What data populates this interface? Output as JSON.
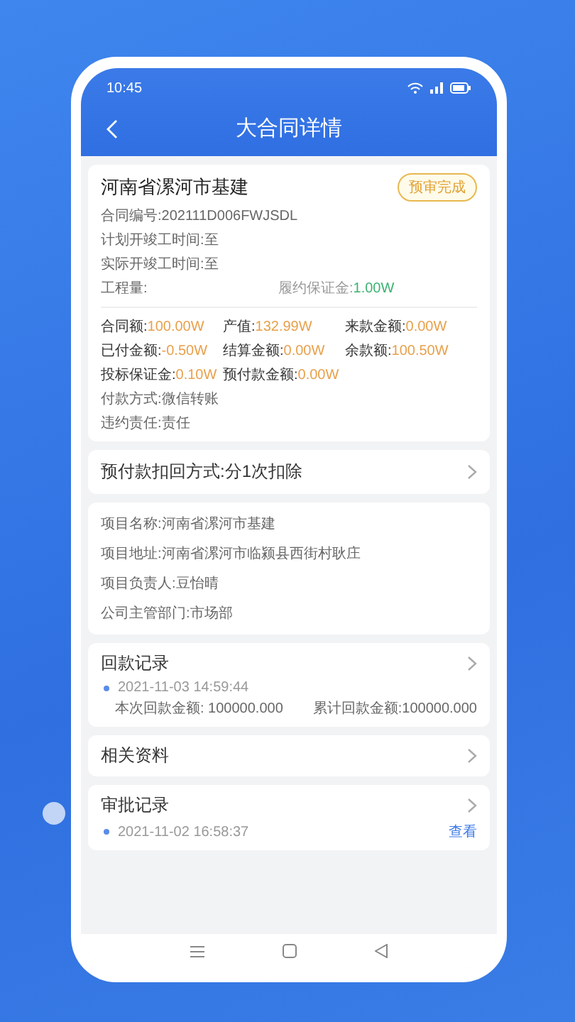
{
  "status_bar": {
    "time": "10:45"
  },
  "header": {
    "title": "大合同详情"
  },
  "contract": {
    "name": "河南省漯河市基建",
    "badge": "预审完成",
    "lines": [
      "合同编号:202111D006FWJSDL",
      "计划开竣工时间:至",
      "实际开竣工时间:至"
    ],
    "quantity_label": "工程量:",
    "deposit": {
      "label": "履约保证金:",
      "value": "1.00W"
    },
    "amounts": [
      {
        "label": "合同额:",
        "value": "100.00W",
        "color": "#e8a04a"
      },
      {
        "label": "产值:",
        "value": "132.99W",
        "color": "#e8a04a"
      },
      {
        "label": "来款金额:",
        "value": "0.00W",
        "color": "#e8a04a"
      },
      {
        "label": "已付金额:",
        "value": "-0.50W",
        "color": "#e8a04a"
      },
      {
        "label": "结算金额:",
        "value": "0.00W",
        "color": "#e8a04a"
      },
      {
        "label": "余款额:",
        "value": "100.50W",
        "color": "#e8a04a"
      },
      {
        "label": "投标保证金:",
        "value": "0.10W",
        "color": "#e8a04a"
      },
      {
        "label": "预付款金额:",
        "value": "0.00W",
        "color": "#e8a04a"
      }
    ],
    "terms": [
      "付款方式:微信转账",
      "违约责任:责任"
    ]
  },
  "prepay": {
    "text": "预付款扣回方式:分1次扣除"
  },
  "project": [
    "项目名称:河南省漯河市基建",
    "项目地址:河南省漯河市临颍县西街村耿庄",
    "项目负责人:豆怡晴",
    "公司主管部门:市场部"
  ],
  "payment_records": {
    "title": "回款记录",
    "date": "2021-11-03 14:59:44",
    "current": "本次回款金额: 100000.000",
    "total": "累计回款金额:100000.000"
  },
  "documents": {
    "title": "相关资料"
  },
  "approval_records": {
    "title": "审批记录",
    "date": "2021-11-02 16:58:37",
    "link": "查看"
  }
}
